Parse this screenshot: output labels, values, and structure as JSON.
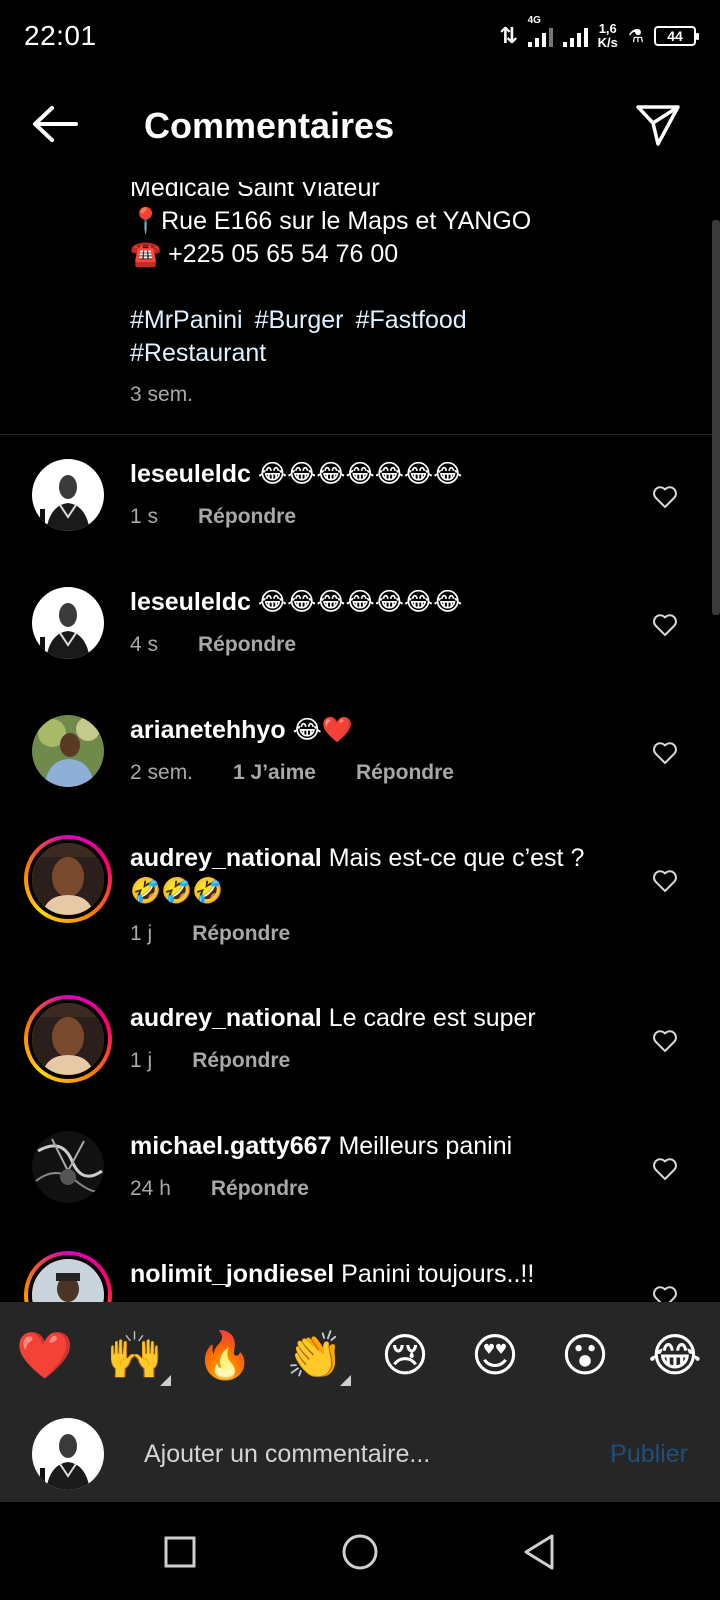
{
  "status_bar": {
    "time": "22:01",
    "network_type": "4G",
    "speed_value": "1,6",
    "speed_unit": "K/s",
    "battery": "44"
  },
  "header": {
    "title": "Commentaires",
    "back_icon": "back-arrow-icon",
    "share_icon": "send-icon"
  },
  "caption": {
    "lines": [
      "Médicale Saint Viateur",
      "📍Rue E166 sur le Maps et YANGO",
      "☎️ +225 05 65 54 76 00"
    ],
    "hashtags": [
      "#MrPanini",
      "#Burger",
      "#Fastfood",
      "#Restaurant"
    ],
    "time": "3 sem."
  },
  "comments": [
    {
      "username": "leseuleldc",
      "text": "😂😂😂😂😂😂😂",
      "time": "1 s",
      "likes": "",
      "reply": "Répondre"
    },
    {
      "username": "leseuleldc",
      "text": "😂😂😂😂😂😂😂",
      "time": "4 s",
      "likes": "",
      "reply": "Répondre"
    },
    {
      "username": "arianetehhyo",
      "text": "😂❤️",
      "time": "2 sem.",
      "likes": "1 J’aime",
      "reply": "Répondre"
    },
    {
      "username": "audrey_national",
      "text": "Mais est-ce que c’est ? 🤣🤣🤣",
      "time": "1 j",
      "likes": "",
      "reply": "Répondre"
    },
    {
      "username": "audrey_national",
      "text": "Le cadre est super",
      "time": "1 j",
      "likes": "",
      "reply": "Répondre"
    },
    {
      "username": "michael.gatty667",
      "text": "Meilleurs panini",
      "time": "24 h",
      "likes": "",
      "reply": "Répondre"
    },
    {
      "username": "nolimit_jondiesel",
      "text": "Panini toujours..!!",
      "time": "",
      "likes": "",
      "reply": ""
    }
  ],
  "emoji_reactions": [
    "❤️",
    "🙌",
    "🔥",
    "👏",
    "😢",
    "😍",
    "😮",
    "😂"
  ],
  "comment_input": {
    "placeholder": "Ajouter un commentaire...",
    "publish_label": "Publier"
  },
  "colors": {
    "background": "#000000",
    "panel": "#262626",
    "secondary_text": "#a8a8a8",
    "publish_disabled": "#1f4f7a",
    "story_ring": "#ff0069"
  }
}
